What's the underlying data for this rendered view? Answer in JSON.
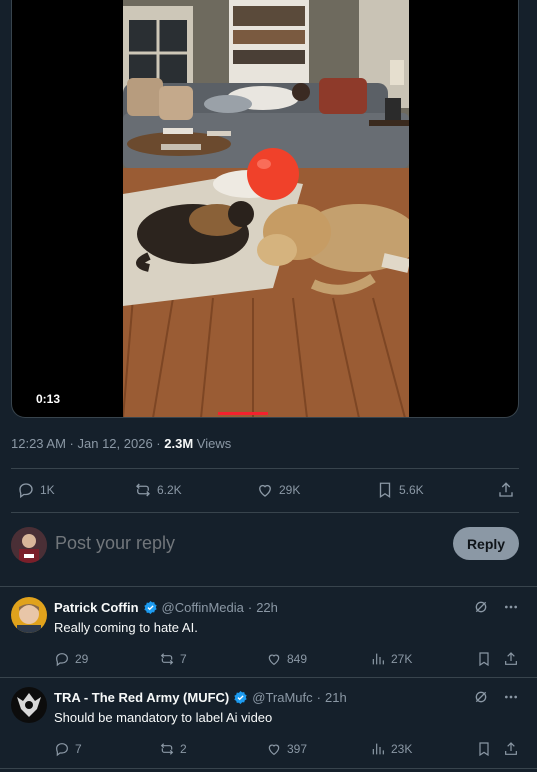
{
  "video": {
    "duration": "0:13"
  },
  "post": {
    "time": "12:23 AM",
    "date": "Jan 12, 2026",
    "views_count": "2.3M",
    "views_label": "Views"
  },
  "actions": {
    "replies": "1K",
    "reposts": "6.2K",
    "likes": "29K",
    "bookmarks": "5.6K"
  },
  "reply_box": {
    "placeholder": "Post your reply",
    "button": "Reply"
  },
  "comments": [
    {
      "name": "Patrick Coffin",
      "handle": "@CoffinMedia",
      "time": "22h",
      "text": "Really coming to hate AI.",
      "replies": "29",
      "reposts": "7",
      "likes": "849",
      "views": "27K"
    },
    {
      "name": "TRA - The Red Army (MUFC)",
      "handle": "@TraMufc",
      "time": "21h",
      "text": "Should be mandatory to label Ai video",
      "replies": "7",
      "reposts": "2",
      "likes": "397",
      "views": "23K"
    }
  ],
  "colors": {
    "background": "#15202b",
    "divider": "#38444d",
    "muted": "#8b98a5",
    "verified": "#1d9bf0",
    "progress": "#f4212e"
  }
}
